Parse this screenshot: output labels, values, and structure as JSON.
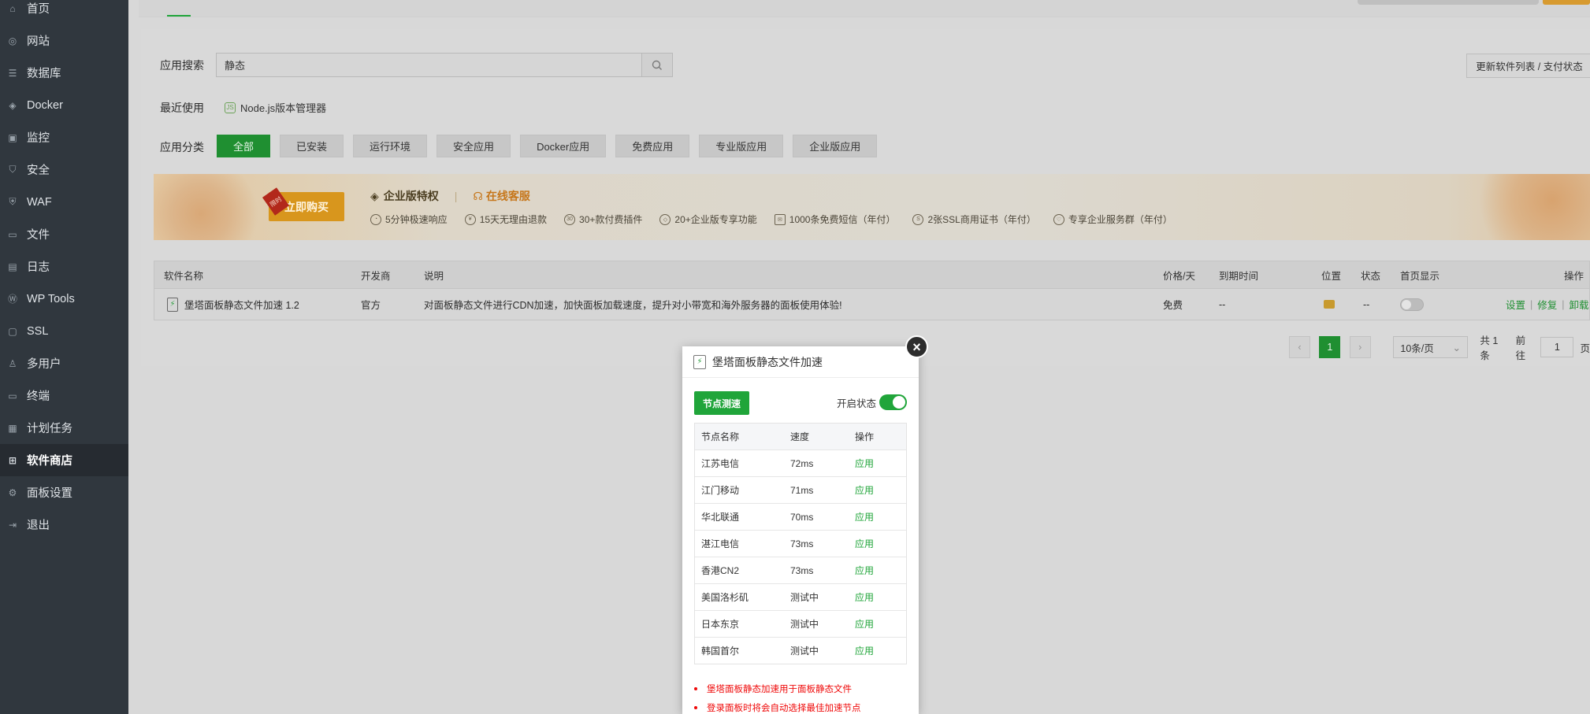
{
  "sidebar": {
    "items": [
      {
        "label": "首页",
        "icon": "home-icon"
      },
      {
        "label": "网站",
        "icon": "globe-icon"
      },
      {
        "label": "数据库",
        "icon": "database-icon"
      },
      {
        "label": "Docker",
        "icon": "docker-icon"
      },
      {
        "label": "监控",
        "icon": "monitor-icon"
      },
      {
        "label": "安全",
        "icon": "shield-icon"
      },
      {
        "label": "WAF",
        "icon": "waf-icon"
      },
      {
        "label": "文件",
        "icon": "folder-icon"
      },
      {
        "label": "日志",
        "icon": "log-icon"
      },
      {
        "label": "WP Tools",
        "icon": "wordpress-icon"
      },
      {
        "label": "SSL",
        "icon": "ssl-icon"
      },
      {
        "label": "多用户",
        "icon": "users-icon"
      },
      {
        "label": "终端",
        "icon": "terminal-icon"
      },
      {
        "label": "计划任务",
        "icon": "calendar-icon"
      },
      {
        "label": "软件商店",
        "icon": "grid-icon",
        "active": true
      },
      {
        "label": "面板设置",
        "icon": "gear-icon"
      },
      {
        "label": "退出",
        "icon": "logout-icon"
      }
    ]
  },
  "store": {
    "search_label": "应用搜索",
    "search_value": "静态",
    "update_button": "更新软件列表 / 支付状态",
    "recent_label": "最近使用",
    "recent_item": "Node.js版本管理器",
    "category_label": "应用分类",
    "categories": [
      "全部",
      "已安装",
      "运行环境",
      "安全应用",
      "Docker应用",
      "免费应用",
      "专业版应用",
      "企业版应用"
    ]
  },
  "banner": {
    "buy_button": "立即购买",
    "ribbon": "限时",
    "enterprise_title": "企业版特权",
    "service_link": "在线客服",
    "features": [
      "5分钟极速响应",
      "15天无理由退款",
      "30+款付费插件",
      "20+企业版专享功能",
      "1000条免费短信（年付）",
      "2张SSL商用证书（年付）",
      "专享企业服务群（年付）"
    ]
  },
  "table": {
    "headers": {
      "name": "软件名称",
      "developer": "开发商",
      "desc": "说明",
      "price": "价格/天",
      "expire": "到期时间",
      "location": "位置",
      "status": "状态",
      "home": "首页显示",
      "ops": "操作"
    },
    "row": {
      "name": "堡塔面板静态文件加速 1.2",
      "developer": "官方",
      "desc": "对面板静态文件进行CDN加速，加快面板加载速度，提升对小带宽和海外服务器的面板使用体验!",
      "price": "免费",
      "expire": "--",
      "status": "--",
      "op_settings": "设置",
      "op_repair": "修复",
      "op_uninstall": "卸载"
    }
  },
  "pager": {
    "current": "1",
    "page_size": "10条/页",
    "total": "共 1 条",
    "goto_label": "前往",
    "goto_value": "1",
    "page_suffix": "页"
  },
  "modal": {
    "title": "堡塔面板静态文件加速",
    "speed_test_button": "节点测速",
    "status_label": "开启状态",
    "status_on": true,
    "headers": {
      "node": "节点名称",
      "speed": "速度",
      "op": "操作"
    },
    "nodes": [
      {
        "name": "江苏电信",
        "speed": "72ms",
        "op": "应用"
      },
      {
        "name": "江门移动",
        "speed": "71ms",
        "op": "应用"
      },
      {
        "name": "华北联通",
        "speed": "70ms",
        "op": "应用"
      },
      {
        "name": "湛江电信",
        "speed": "73ms",
        "op": "应用"
      },
      {
        "name": "香港CN2",
        "speed": "73ms",
        "op": "应用"
      },
      {
        "name": "美国洛杉矶",
        "speed": "测试中",
        "op": "应用"
      },
      {
        "name": "日本东京",
        "speed": "测试中",
        "op": "应用"
      },
      {
        "name": "韩国首尔",
        "speed": "测试中",
        "op": "应用"
      }
    ],
    "notes": [
      "堡塔面板静态加速用于面板静态文件",
      "登录面板时将会自动选择最佳加速节点"
    ]
  },
  "colors": {
    "accent": "#20a53a",
    "sidebar_bg": "#30373e",
    "danger": "#ef0808",
    "buy_orange": "#d8961d"
  }
}
